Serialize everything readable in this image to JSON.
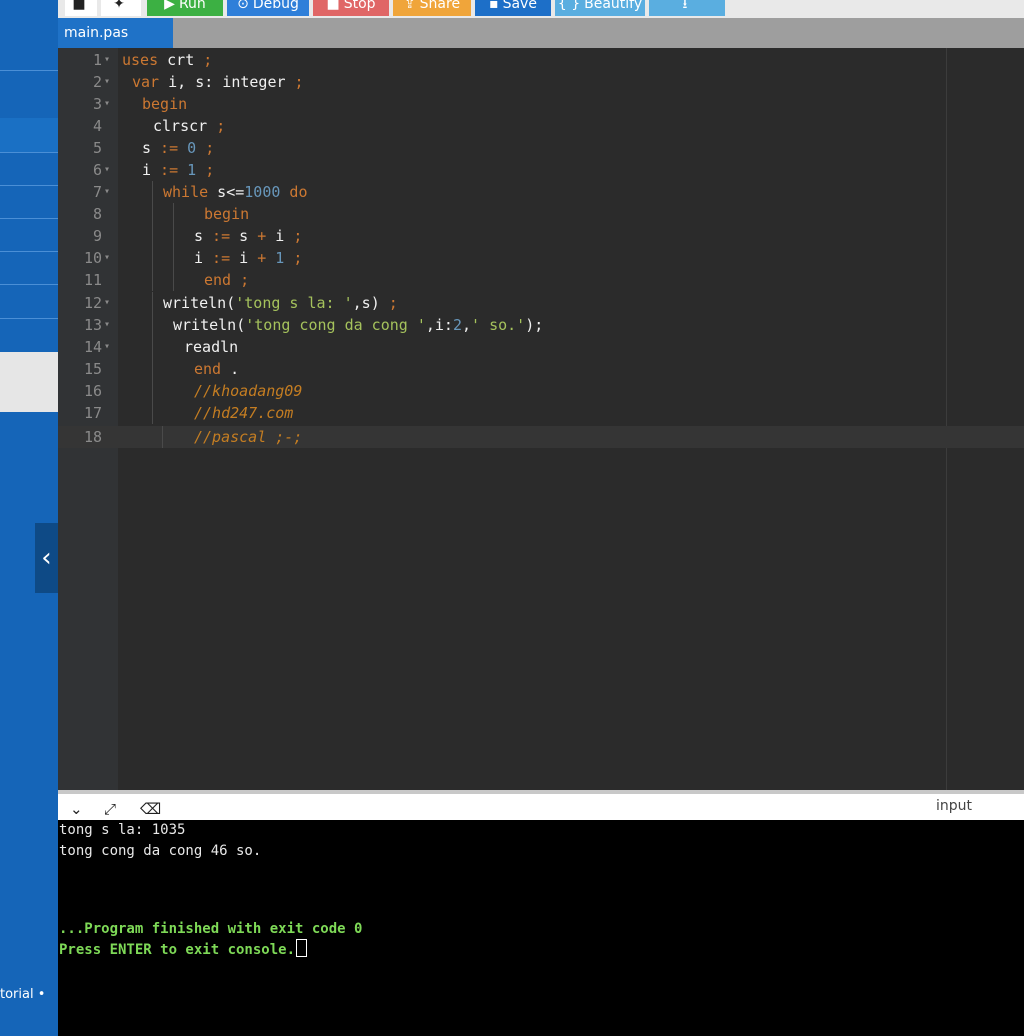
{
  "toolbar": {
    "buttons": [
      {
        "label": "",
        "icon": "stop-square-icon",
        "color": "#ffffff"
      },
      {
        "label": "",
        "icon": "settings-icon",
        "color": "#ffffff"
      },
      {
        "label": "Run",
        "icon": "play-icon",
        "color": "#3cb043"
      },
      {
        "label": "Debug",
        "icon": "debug-icon",
        "color": "#2f7fd9"
      },
      {
        "label": "Stop",
        "icon": "stop-icon",
        "color": "#e06666"
      },
      {
        "label": "Share",
        "icon": "share-icon",
        "color": "#f0a53a"
      },
      {
        "label": "Save",
        "icon": "save-icon",
        "color": "#1d6fc8"
      },
      {
        "label": "Beautify",
        "icon": "braces-icon",
        "color": "#5aaee0"
      },
      {
        "label": "",
        "icon": "download-icon",
        "color": "#5aaee0"
      }
    ]
  },
  "tab": {
    "label": "main.pas"
  },
  "editor": {
    "lines": [
      {
        "n": "1",
        "fold": true
      },
      {
        "n": "2",
        "fold": true
      },
      {
        "n": "3",
        "fold": true
      },
      {
        "n": "4",
        "fold": false
      },
      {
        "n": "5",
        "fold": false
      },
      {
        "n": "6",
        "fold": true
      },
      {
        "n": "7",
        "fold": true
      },
      {
        "n": "8",
        "fold": false
      },
      {
        "n": "9",
        "fold": false
      },
      {
        "n": "10",
        "fold": true
      },
      {
        "n": "11",
        "fold": false
      },
      {
        "n": "12",
        "fold": true
      },
      {
        "n": "13",
        "fold": true
      },
      {
        "n": "14",
        "fold": true
      },
      {
        "n": "15",
        "fold": false
      },
      {
        "n": "16",
        "fold": false
      },
      {
        "n": "17",
        "fold": false
      },
      {
        "n": "18",
        "fold": false
      }
    ],
    "code": {
      "l1": {
        "a": "uses",
        "b": " crt",
        "c": " ;"
      },
      "l2": {
        "a": "var",
        "b": " i, s: integer",
        "c": " ;"
      },
      "l3": {
        "a": "begin"
      },
      "l4": {
        "b": "clrscr",
        "c": " ;"
      },
      "l5": {
        "b": "s",
        "c": " := ",
        "d": "0",
        "e": " ;"
      },
      "l6": {
        "b": "i",
        "c": " := ",
        "d": "1",
        "e": " ;"
      },
      "l7": {
        "a": "while",
        "b": " s<=",
        "d": "1000",
        "e": " do"
      },
      "l8": {
        "a": "begin"
      },
      "l9": {
        "b": "s",
        "c": " := ",
        "b2": "s",
        "c2": " + ",
        "b3": "i",
        "e": " ;"
      },
      "l10": {
        "b": "i",
        "c": " := ",
        "b2": "i",
        "c2": " + ",
        "d": "1",
        "e": " ;"
      },
      "l11": {
        "a": "end",
        "c": " ;"
      },
      "l12": {
        "b": "writeln(",
        "s": "'tong s la: '",
        "b2": ",s)",
        "c": " ;"
      },
      "l13": {
        "b": "writeln(",
        "s": "'tong cong da cong '",
        "b2": ",i:",
        "d": "2",
        "b3": ",",
        "s2": "' so.'",
        "b4": ");"
      },
      "l14": {
        "b": "readln"
      },
      "l15": {
        "a": "end",
        "b": " ."
      },
      "l16": {
        "cm": "//khoadang09"
      },
      "l17": {
        "cm": "//hd247.com"
      },
      "l18": {
        "cm": "//pascal ;-;"
      }
    }
  },
  "console_header": {
    "input_label": "input"
  },
  "console": {
    "line1": "tong s la: 1035",
    "line2": "tong cong da cong 46 so.",
    "line3": "...Program finished with exit code 0",
    "line4": "Press ENTER to exit console."
  },
  "sidebar": {
    "footer_text": "torial •"
  }
}
